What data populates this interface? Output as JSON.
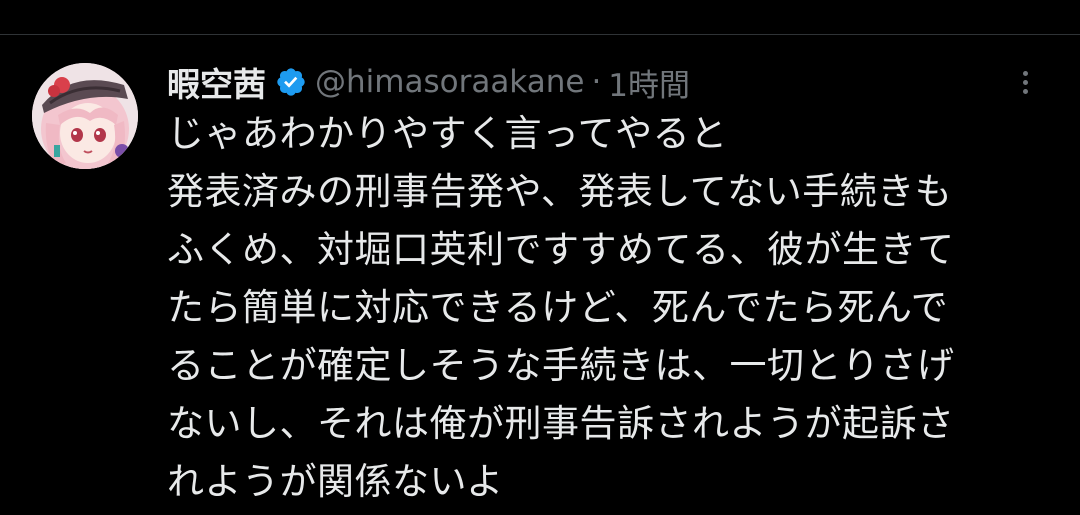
{
  "tweet": {
    "display_name": "暇空茜",
    "verified": true,
    "handle": "@himasoraakane",
    "separator": "·",
    "time": "1時間",
    "lines": [
      "じゃあわかりやすく言ってやると",
      "発表済みの刑事告発や、発表してない手続きも",
      "ふくめ、対堀口英利ですすめてる、彼が生きて",
      "たら簡単に対応できるけど、死んでたら死んで",
      "ることが確定しそうな手続きは、一切とりさげ",
      "ないし、それは俺が刑事告訴されようが起訴さ",
      "れようが関係ないよ"
    ],
    "icons": {
      "verified": "verified-badge-icon",
      "more": "more-options-icon",
      "avatar": "anime-character-avatar"
    }
  },
  "colors": {
    "background": "#000000",
    "text": "#e7e9ea",
    "secondary": "#71767b",
    "verified": "#1d9bf0",
    "divider": "#2f3336"
  }
}
